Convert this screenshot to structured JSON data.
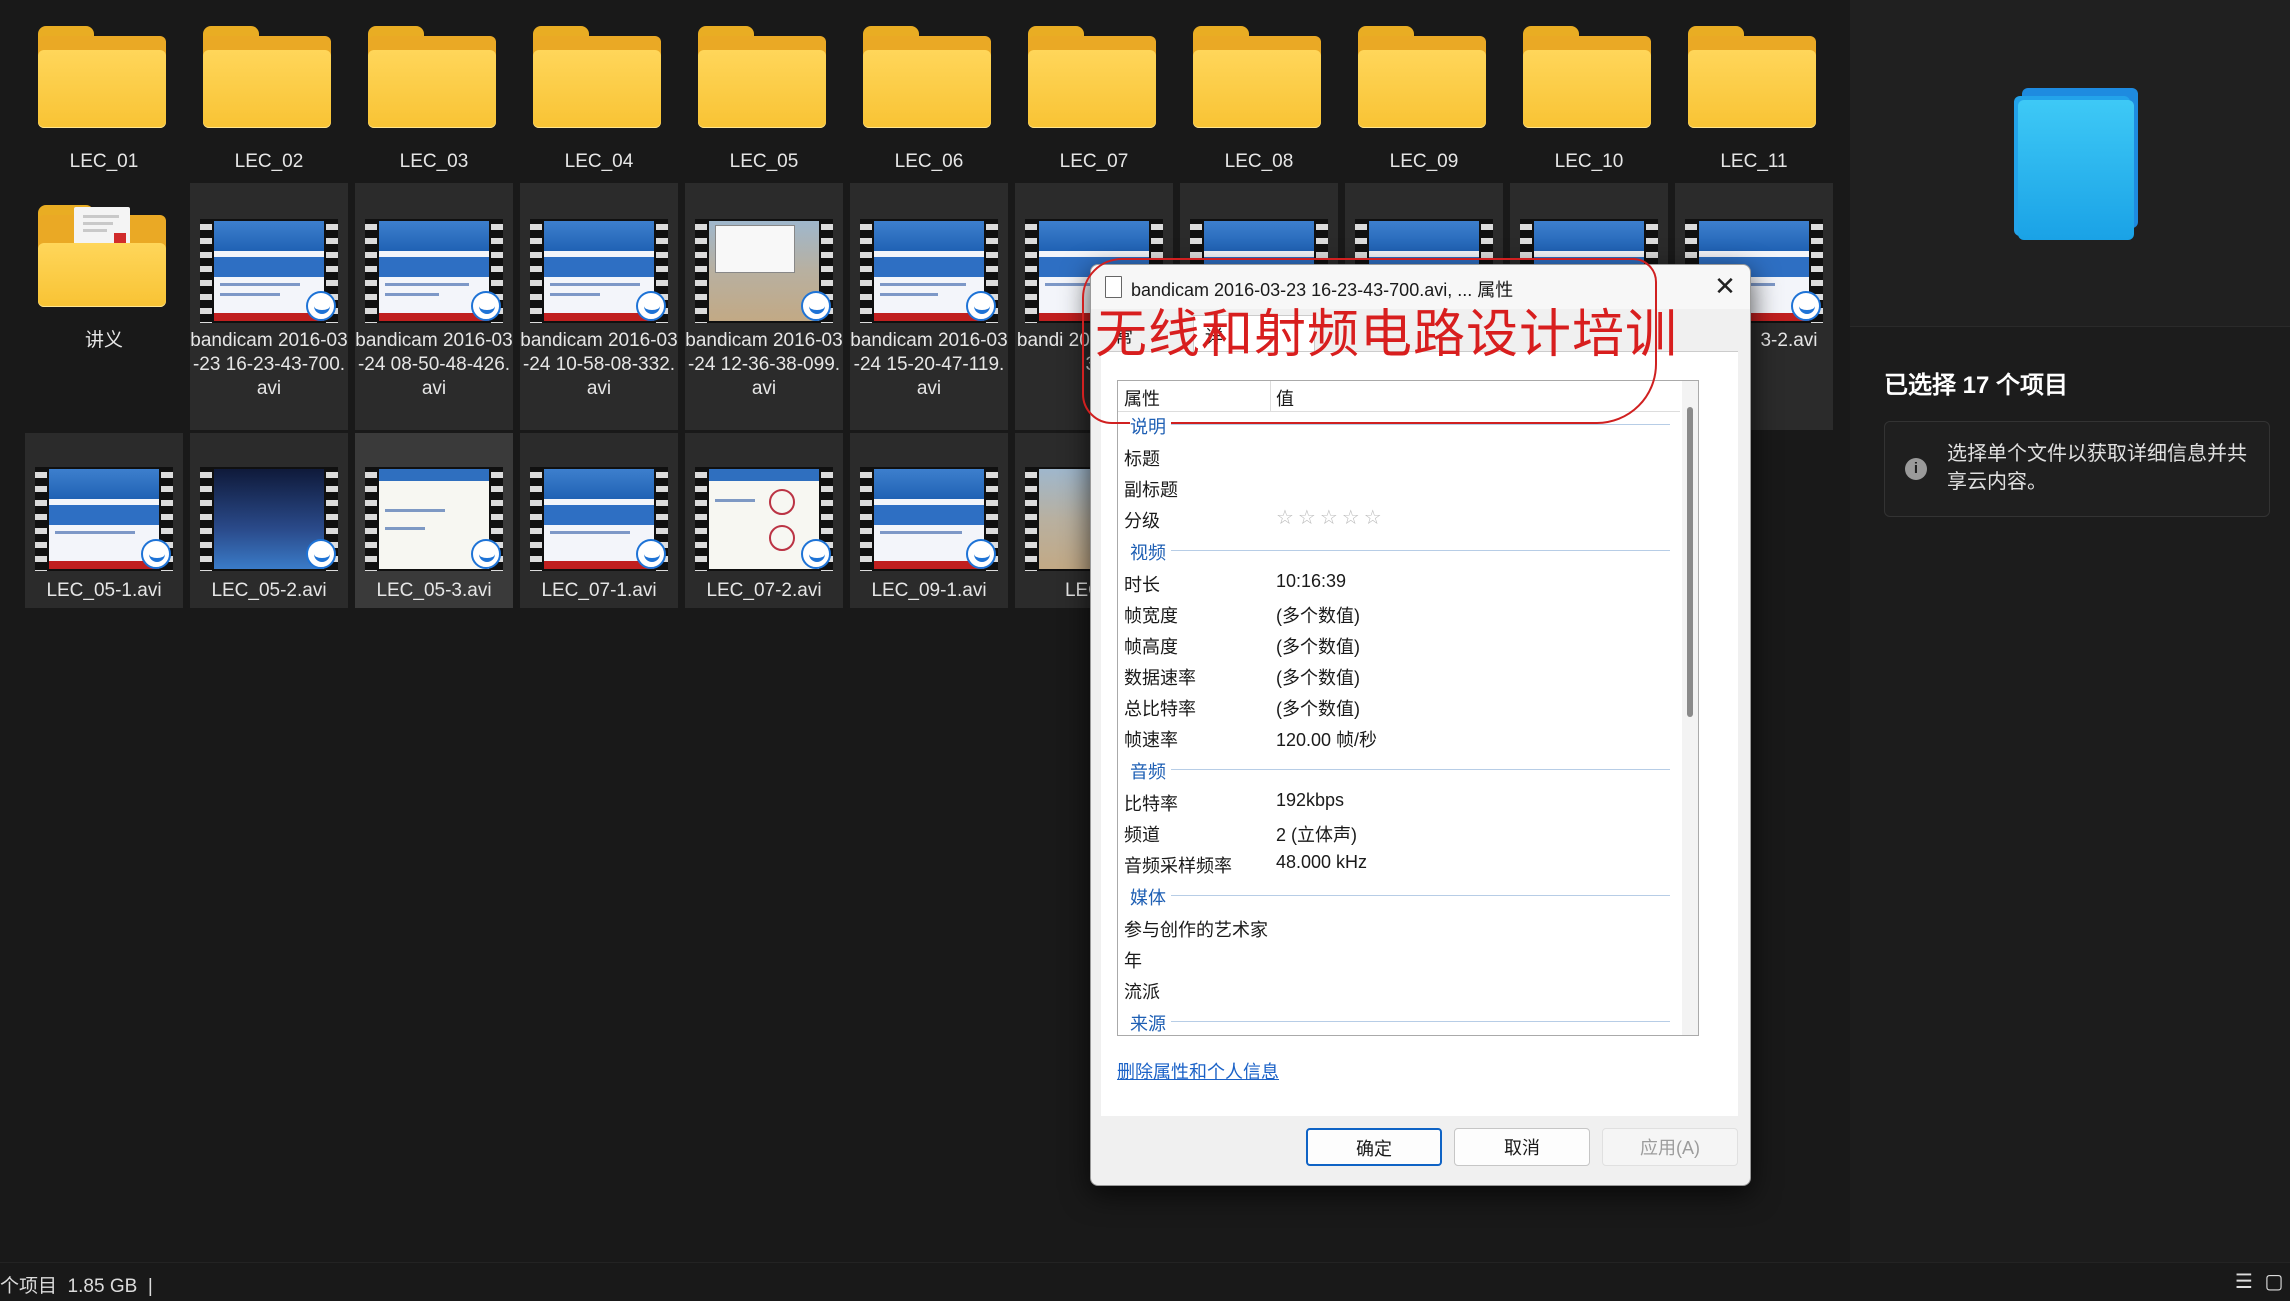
{
  "folders": [
    "LEC_01",
    "LEC_02",
    "LEC_03",
    "LEC_04",
    "LEC_05",
    "LEC_06",
    "LEC_07",
    "LEC_08",
    "LEC_09",
    "LEC_10",
    "LEC_11"
  ],
  "row2": [
    {
      "label": "讲义",
      "kind": "folder"
    },
    {
      "label": "bandicam 2016-03-23 16-23-43-700.avi",
      "kind": "video"
    },
    {
      "label": "bandicam 2016-03-24 08-50-48-426.avi",
      "kind": "video"
    },
    {
      "label": "bandicam 2016-03-24 10-58-08-332.avi",
      "kind": "video"
    },
    {
      "label": "bandicam 2016-03-24 12-36-38-099.avi",
      "kind": "video"
    },
    {
      "label": "bandicam 2016-03-24 15-20-47-119.avi",
      "kind": "video"
    },
    {
      "label": "bandi 2016-0 15-43-",
      "kind": "video"
    },
    {
      "label": "",
      "kind": "video"
    },
    {
      "label": "",
      "kind": "video"
    },
    {
      "label": "",
      "kind": "video"
    },
    {
      "label": "3-2.avi",
      "kind": "video"
    }
  ],
  "row3": [
    "LEC_05-1.avi",
    "LEC_05-2.avi",
    "LEC_05-3.avi",
    "LEC_07-1.avi",
    "LEC_07-2.avi",
    "LEC_09-1.avi",
    "LEC_0"
  ],
  "detail_pane": {
    "selected_count": "已选择 17 个项目",
    "info_text": "选择单个文件以获取详细信息并共享云内容。",
    "info_icon": "i"
  },
  "status_bar": {
    "text": "个项目  1.85 GB  |",
    "details_view_icon": "☰",
    "tiles_view_icon": "▢"
  },
  "dialog": {
    "title": "bandicam 2016-03-23 16-23-43-700.avi, ... 属性",
    "close": "✕",
    "tabs": [
      "常规",
      "详细信息"
    ],
    "columns": {
      "property": "属性",
      "value": "值"
    },
    "sections": {
      "description": "说明",
      "video": "视频",
      "audio": "音频",
      "media": "媒体",
      "origin": "来源"
    },
    "description_props": [
      {
        "name": "标题",
        "value": ""
      },
      {
        "name": "副标题",
        "value": ""
      },
      {
        "name": "分级",
        "value": "☆☆☆☆☆"
      }
    ],
    "video_props": [
      {
        "name": "时长",
        "value": "10:16:39"
      },
      {
        "name": "帧宽度",
        "value": "(多个数值)"
      },
      {
        "name": "帧高度",
        "value": "(多个数值)"
      },
      {
        "name": "数据速率",
        "value": "(多个数值)"
      },
      {
        "name": "总比特率",
        "value": "(多个数值)"
      },
      {
        "name": "帧速率",
        "value": "120.00 帧/秒"
      }
    ],
    "audio_props": [
      {
        "name": "比特率",
        "value": "192kbps"
      },
      {
        "name": "频道",
        "value": "2 (立体声)"
      },
      {
        "name": "音频采样频率",
        "value": "48.000 kHz"
      }
    ],
    "media_props": [
      {
        "name": "参与创作的艺术家",
        "value": ""
      },
      {
        "name": "年",
        "value": ""
      },
      {
        "name": "流派",
        "value": ""
      }
    ],
    "remove_link": "删除属性和个人信息",
    "buttons": {
      "ok": "确定",
      "cancel": "取消",
      "apply": "应用(A)"
    }
  },
  "overlay_text": "无线和射频电路设计培训",
  "colors": {
    "folder": "#f8c334",
    "accent": "#1e73d6",
    "overlay": "#d81e1e"
  }
}
